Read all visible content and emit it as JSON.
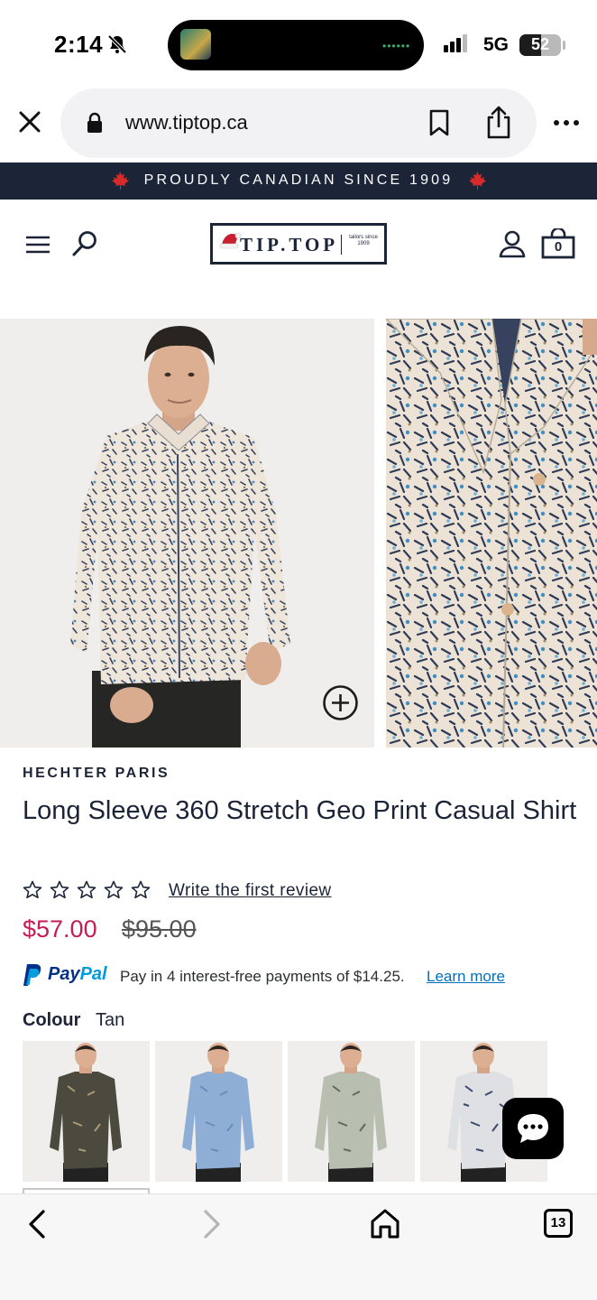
{
  "status_bar": {
    "time": "2:14",
    "network": "5G",
    "battery": "52",
    "battery_level": 0.52,
    "live_activity_art": "album-art"
  },
  "browser": {
    "url": "www.tiptop.ca",
    "icons": [
      "close-icon",
      "lock-icon",
      "bookmark-icon",
      "share-icon",
      "more-icon"
    ]
  },
  "announcement": {
    "text": "PROUDLY CANADIAN SINCE 1909",
    "icon": "maple-leaf-icon",
    "bg_color": "#1c2438"
  },
  "header": {
    "logo": {
      "wordmark": "TIP.TOP",
      "tagline": "tailors since 1909"
    },
    "cart_count": "0",
    "icons": [
      "menu-icon",
      "search-icon",
      "account-icon",
      "bag-icon"
    ]
  },
  "product": {
    "brand": "HECHTER PARIS",
    "title": "Long Sleeve 360 Stretch Geo Print Casual Shirt",
    "rating_stars": 0,
    "rating_max": 5,
    "review_link": "Write the first review",
    "price": "$57.00",
    "compare_price": "$95.00",
    "price_color": "#c21d55",
    "paypal": {
      "word_pay": "Pay",
      "word_pal": "Pal",
      "message": "Pay in 4 interest-free payments of $14.25.",
      "link": "Learn more"
    },
    "colour_label": "Colour",
    "colour_value": "Tan",
    "swatch_count": 4
  },
  "gallery": {
    "images": [
      "model-front-photo",
      "collar-detail-photo"
    ],
    "zoom_icon": "zoom-plus-icon"
  },
  "chat": {
    "icon": "chat-bubble-icon"
  },
  "toolbar": {
    "tab_count": "13",
    "icons": [
      "back-icon",
      "forward-icon",
      "home-icon",
      "tabs-icon"
    ]
  }
}
